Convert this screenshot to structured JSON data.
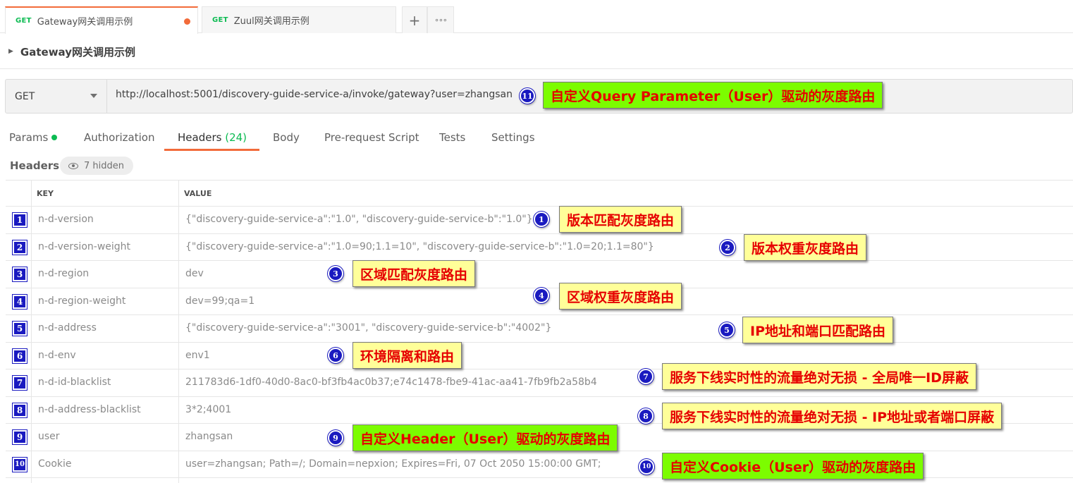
{
  "tabs": [
    {
      "method": "GET",
      "name": "Gateway网关调用示例",
      "active": true,
      "unsaved": true
    },
    {
      "method": "GET",
      "name": "Zuul网关调用示例",
      "active": false,
      "unsaved": false
    }
  ],
  "tab_actions": {
    "new_tab": "+",
    "more": "∘∘∘"
  },
  "request": {
    "title": "Gateway网关调用示例",
    "method": "GET",
    "url": "http://localhost:5001/discovery-guide-service-a/invoke/gateway?user=zhangsan"
  },
  "subtabs": {
    "params": "Params",
    "authorization": "Authorization",
    "headers": "Headers",
    "headers_count": "(24)",
    "body": "Body",
    "prerequest": "Pre-request Script",
    "tests": "Tests",
    "settings": "Settings"
  },
  "headers_section": {
    "label": "Headers",
    "hidden": "7 hidden"
  },
  "table": {
    "key_col": "KEY",
    "value_col": "VALUE",
    "rows": [
      {
        "num": "1",
        "key": "n-d-version",
        "value": "{\"discovery-guide-service-a\":\"1.0\", \"discovery-guide-service-b\":\"1.0\"}"
      },
      {
        "num": "2",
        "key": "n-d-version-weight",
        "value": "{\"discovery-guide-service-a\":\"1.0=90;1.1=10\", \"discovery-guide-service-b\":\"1.0=20;1.1=80\"}"
      },
      {
        "num": "3",
        "key": "n-d-region",
        "value": "dev"
      },
      {
        "num": "4",
        "key": "n-d-region-weight",
        "value": "dev=99;qa=1"
      },
      {
        "num": "5",
        "key": "n-d-address",
        "value": "{\"discovery-guide-service-a\":\"3001\", \"discovery-guide-service-b\":\"4002\"}"
      },
      {
        "num": "6",
        "key": "n-d-env",
        "value": "env1"
      },
      {
        "num": "7",
        "key": "n-d-id-blacklist",
        "value": "211783d6-1df0-40d0-8ac0-bf3fb4ac0b37;e74c1478-fbe9-41ac-aa41-7fb9fb2a58b4"
      },
      {
        "num": "8",
        "key": "n-d-address-blacklist",
        "value": "3*2;4001"
      },
      {
        "num": "9",
        "key": "user",
        "value": "zhangsan"
      },
      {
        "num": "10",
        "key": "Cookie",
        "value": "user=zhangsan; Path=/; Domain=nepxion; Expires=Fri, 07 Oct 2050 15:00:00 GMT;"
      }
    ]
  },
  "annotations": [
    {
      "num": "11",
      "text": "自定义Query Parameter（User）驱动的灰度路由",
      "color": "#7cfc00"
    },
    {
      "num": "1",
      "text": "版本匹配灰度路由",
      "color": "#ffff99"
    },
    {
      "num": "2",
      "text": "版本权重灰度路由",
      "color": "#ffff99"
    },
    {
      "num": "3",
      "text": "区域匹配灰度路由",
      "color": "#ffff99"
    },
    {
      "num": "4",
      "text": "区域权重灰度路由",
      "color": "#ffff99"
    },
    {
      "num": "5",
      "text": "IP地址和端口匹配路由",
      "color": "#ffff99"
    },
    {
      "num": "6",
      "text": "环境隔离和路由",
      "color": "#ffff99"
    },
    {
      "num": "7",
      "text": "服务下线实时性的流量绝对无损 - 全局唯一ID屏蔽",
      "color": "#ffff99"
    },
    {
      "num": "8",
      "text": "服务下线实时性的流量绝对无损 - IP地址或者端口屏蔽",
      "color": "#ffff99"
    },
    {
      "num": "9",
      "text": "自定义Header（User）驱动的灰度路由",
      "color": "#7cfc00"
    },
    {
      "num": "10",
      "text": "自定义Cookie（User）驱动的灰度路由",
      "color": "#7cfc00"
    }
  ],
  "colors": {
    "accent": "#f26b3a",
    "method_green": "#0cbb52",
    "marker_blue": "#1a1ac0",
    "note_red": "#e60000"
  }
}
